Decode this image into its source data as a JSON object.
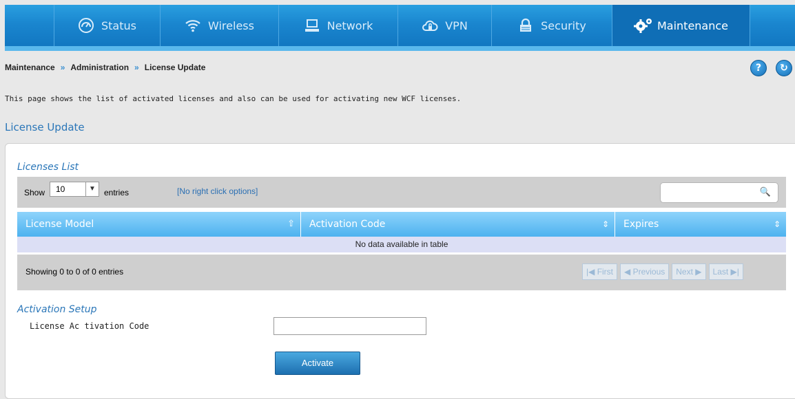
{
  "nav": {
    "items": [
      {
        "label": "Status",
        "icon": "gauge-icon"
      },
      {
        "label": "Wireless",
        "icon": "wifi-icon"
      },
      {
        "label": "Network",
        "icon": "monitor-icon"
      },
      {
        "label": "VPN",
        "icon": "cloud-lock-icon"
      },
      {
        "label": "Security",
        "icon": "lock-icon"
      },
      {
        "label": "Maintenance",
        "icon": "gears-icon",
        "active": true
      }
    ]
  },
  "breadcrumb": {
    "items": [
      "Maintenance",
      "Administration",
      "License Update"
    ],
    "separator": "»"
  },
  "header_icons": {
    "help": "?",
    "refresh": "↻"
  },
  "description": "This page shows the list of activated licenses and also can be used for activating new WCF licenses.",
  "page_heading": "License Update",
  "licenses": {
    "section_title": "Licenses List",
    "show_label": "Show",
    "entries_value": "10",
    "entries_label": "entries",
    "right_click_note": "[No right click options]",
    "search_value": "",
    "columns": [
      "License Model",
      "Activation Code",
      "Expires"
    ],
    "empty_message": "No data available in table",
    "info": "Showing 0 to 0 of 0 entries",
    "pager": {
      "first": "First",
      "previous": "Previous",
      "next": "Next",
      "last": "Last"
    }
  },
  "activation": {
    "section_title": "Activation Setup",
    "field_label": "License Ac tivation Code",
    "field_value": "",
    "button_label": "Activate"
  },
  "colors": {
    "nav_blue": "#1a86cf",
    "heading_blue": "#2a76b8",
    "table_header": "#4db2ef",
    "empty_row": "#dcdff5"
  }
}
